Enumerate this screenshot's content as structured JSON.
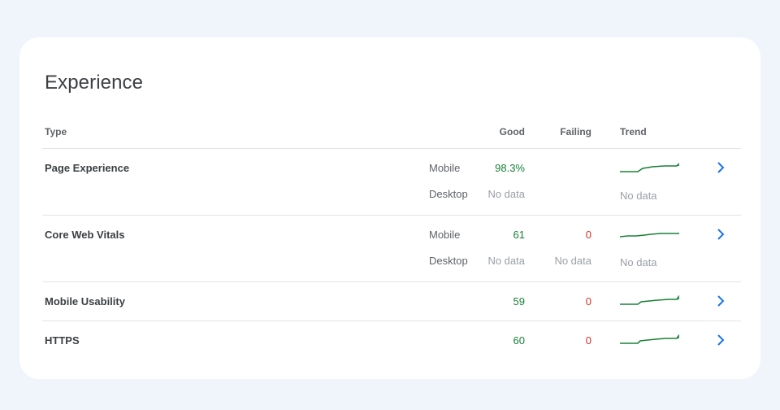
{
  "card": {
    "title": "Experience"
  },
  "table": {
    "headers": {
      "type": "Type",
      "good": "Good",
      "failing": "Failing",
      "trend": "Trend"
    },
    "rows": [
      {
        "type": "Page Experience",
        "mobile": {
          "device": "Mobile",
          "good": "98.3%",
          "failing": "",
          "trend": "sparkline"
        },
        "desktop": {
          "device": "Desktop",
          "good": "No data",
          "failing": "",
          "trend": "No data"
        }
      },
      {
        "type": "Core Web Vitals",
        "mobile": {
          "device": "Mobile",
          "good": "61",
          "failing": "0",
          "trend": "sparkline"
        },
        "desktop": {
          "device": "Desktop",
          "good": "No data",
          "failing": "No data",
          "trend": "No data"
        }
      },
      {
        "type": "Mobile Usability",
        "good": "59",
        "failing": "0",
        "trend": "sparkline"
      },
      {
        "type": "HTTPS",
        "good": "60",
        "failing": "0",
        "trend": "sparkline"
      }
    ]
  },
  "colors": {
    "good": "#188038",
    "failing": "#d93025",
    "link": "#1a73e8",
    "trend": "#188038"
  },
  "icons": {
    "row_link": "chevron-right-icon"
  }
}
